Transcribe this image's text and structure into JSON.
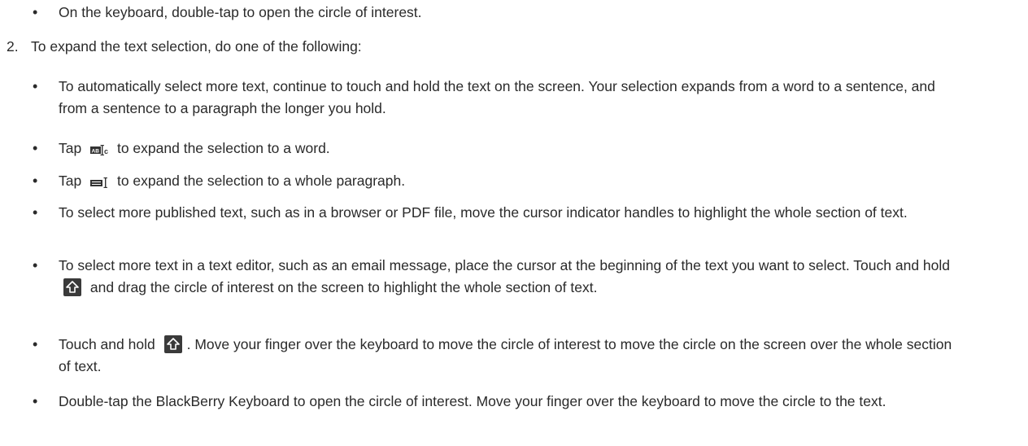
{
  "list": {
    "top_bullet": "On the keyboard, double-tap to open the circle of interest.",
    "step2": {
      "number": "2.",
      "text": "To expand the text selection, do one of the following:"
    },
    "bullets": {
      "b1": "To automatically select more text, continue to touch and hold the text on the screen. Your selection expands from a word to a sentence, and from a sentence to a paragraph the longer you hold.",
      "b2_pre": "Tap",
      "b2_post": "to expand the selection to a word.",
      "b3_pre": "Tap",
      "b3_post": "to expand the selection to a whole paragraph.",
      "b4": "To select more published text, such as in a browser or PDF file, move the cursor indicator handles to highlight the whole section of text.",
      "b5_pre": "To select more text in a text editor, such as an email message, place the cursor at the beginning of the text you want to select. Touch and hold",
      "b5_post": "and drag the circle of interest on the screen to highlight the whole section of text.",
      "b6_pre": "Touch and hold",
      "b6_post": ". Move your finger over the keyboard to move the circle of interest to move the circle on the screen over the whole section of text.",
      "b7": "Double-tap the BlackBerry Keyboard to open the circle of interest. Move your finger over the keyboard to move the circle to the text."
    }
  },
  "icons": {
    "word_select": "word-select-icon",
    "paragraph_select": "paragraph-select-icon",
    "shift_key": "shift-key-icon"
  }
}
